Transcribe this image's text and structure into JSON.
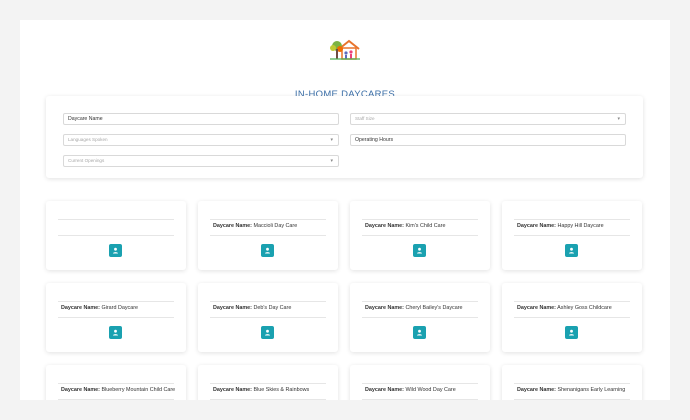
{
  "header": {
    "title": "IN-HOME DAYCARES"
  },
  "filters": {
    "daycare_name": "Daycare Name",
    "staff_size": "Staff Size",
    "languages": "Languages Spoken",
    "operating_hours": "Operating Hours",
    "openings": "Current Openings"
  },
  "label": "Daycare Name:",
  "cards": [
    {
      "name": ""
    },
    {
      "name": "Maccioli Day Care"
    },
    {
      "name": "Kim's Child Care"
    },
    {
      "name": "Happy Hill Daycare"
    },
    {
      "name": "Girard Daycare"
    },
    {
      "name": "Deb's Day Care"
    },
    {
      "name": "Cheryl Bailey's Daycare"
    },
    {
      "name": "Ashley Goss Childcare"
    },
    {
      "name": "Blueberry Mountain Child Care"
    },
    {
      "name": "Blue Skies & Rainbows"
    },
    {
      "name": "Wild Wood Day Care"
    },
    {
      "name": "Shenanigans Early Learning"
    }
  ],
  "colors": {
    "accent": "#1aa1b0",
    "title": "#3b6fa8"
  }
}
